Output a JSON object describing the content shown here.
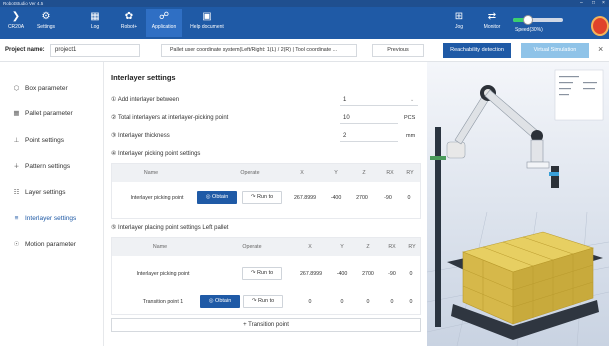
{
  "titlebar": {
    "title": "RobotStudio Ver 4.5"
  },
  "toolbar": {
    "items": [
      {
        "label": "CR20A",
        "icon": "robot-arm-icon"
      },
      {
        "label": "Settings",
        "icon": "gear-icon"
      },
      {
        "label": "Log",
        "icon": "log-icon"
      },
      {
        "label": "Robot+",
        "icon": "plugin-icon"
      },
      {
        "label": "Application",
        "icon": "application-icon"
      },
      {
        "label": "Help document",
        "icon": "help-icon"
      },
      {
        "label": "Jog",
        "icon": "jog-icon"
      },
      {
        "label": "Monitor",
        "icon": "monitor-icon"
      }
    ],
    "speed_label": "Speed(30%)",
    "speed_value": "30",
    "speed_fraction": 0.3
  },
  "project": {
    "label": "Project name:",
    "value": "project1",
    "coord_select": "Pallet user coordinate system(Left/Right: 1(L) / 2(R) | Tool coordinate ...",
    "previous": "Previous",
    "reachability": "Reachability detection",
    "virtual_sim": "Virtual Simulation"
  },
  "sidebar": {
    "items": [
      {
        "label": "Box parameter",
        "icon": "box-icon"
      },
      {
        "label": "Pallet parameter",
        "icon": "pallet-icon"
      },
      {
        "label": "Point settings",
        "icon": "point-icon"
      },
      {
        "label": "Pattern settings",
        "icon": "pattern-icon"
      },
      {
        "label": "Layer settings",
        "icon": "layer-icon"
      },
      {
        "label": "Interlayer settings",
        "icon": "interlayer-icon"
      },
      {
        "label": "Motion parameter",
        "icon": "motion-icon"
      }
    ]
  },
  "main": {
    "title": "Interlayer settings",
    "add_between_label": "① Add interlayer between",
    "add_between_value": "1",
    "total_label": "② Total interlayers at interlayer-picking point",
    "total_value": "10",
    "total_unit": "PCS",
    "thickness_label": "③ Interlayer thickness",
    "thickness_value": "2",
    "thickness_unit": "mm",
    "picking_title": "④ Interlayer picking point settings",
    "placing_title": "⑤ Interlayer placing point settings   Left pallet",
    "headers": [
      "Name",
      "Operate",
      "X",
      "Y",
      "Z",
      "RX",
      "RY"
    ],
    "picking_rows": [
      {
        "name": "Interlayer picking point",
        "obtain": "Obtain",
        "run": "Run to",
        "x": "267.8999",
        "y": "-400",
        "z": "2700",
        "rx": "-90",
        "ry": "0"
      }
    ],
    "placing_rows": [
      {
        "name": "Interlayer picking point",
        "obtain": "",
        "run": "Run to",
        "x": "267.8999",
        "y": "-400",
        "z": "2700",
        "rx": "-90",
        "ry": "0"
      },
      {
        "name": "Transition point 1",
        "obtain": "Obtain",
        "run": "Run to",
        "x": "0",
        "y": "0",
        "z": "0",
        "rx": "0",
        "ry": "0"
      }
    ],
    "add_button": "+ Transition point"
  }
}
